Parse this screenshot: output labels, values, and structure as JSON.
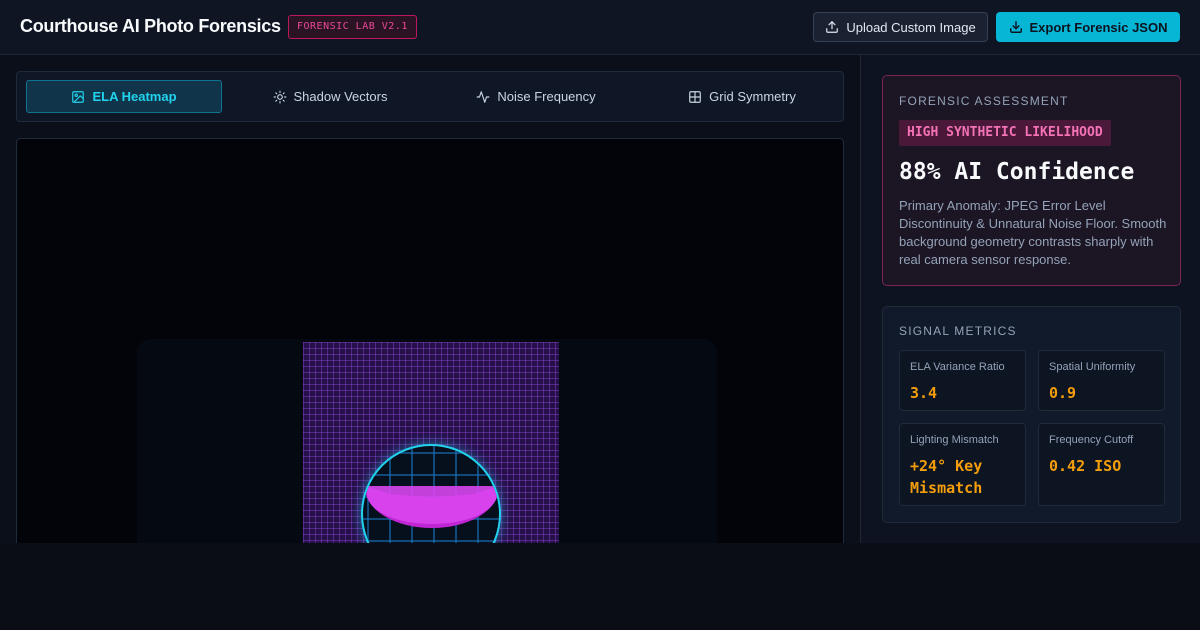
{
  "header": {
    "title": "Courthouse AI Photo Forensics",
    "badge": "FORENSIC LAB V2.1",
    "upload_label": "Upload Custom Image",
    "export_label": "Export Forensic JSON"
  },
  "tabs": [
    {
      "label": "ELA Heatmap",
      "icon": "image-icon",
      "active": true
    },
    {
      "label": "Shadow Vectors",
      "icon": "sun-icon",
      "active": false
    },
    {
      "label": "Noise Frequency",
      "icon": "activity-icon",
      "active": false
    },
    {
      "label": "Grid Symmetry",
      "icon": "grid-icon",
      "active": false
    }
  ],
  "assessment": {
    "section_label": "FORENSIC ASSESSMENT",
    "likelihood": "HIGH SYNTHETIC LIKELIHOOD",
    "confidence": "88% AI Confidence",
    "anomaly": "Primary Anomaly: JPEG Error Level Discontinuity & Unnatural Noise Floor. Smooth background geometry contrasts sharply with real camera sensor response."
  },
  "metrics": {
    "section_label": "SIGNAL METRICS",
    "items": [
      {
        "name": "ELA Variance Ratio",
        "value": "3.4"
      },
      {
        "name": "Spatial Uniformity",
        "value": "0.9"
      },
      {
        "name": "Lighting Mismatch",
        "value": "+24° Key Mismatch"
      },
      {
        "name": "Frequency Cutoff",
        "value": "0.42 ISO"
      }
    ]
  },
  "colors": {
    "accent": "#06b6d4",
    "danger": "#ec4899",
    "metric": "#f59e0b",
    "background": "#0b0f19"
  }
}
